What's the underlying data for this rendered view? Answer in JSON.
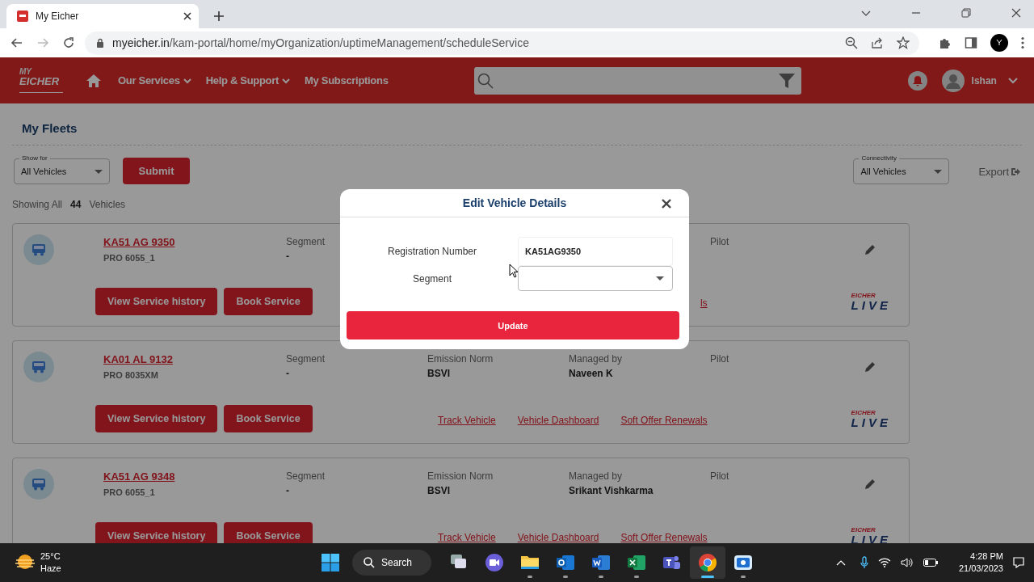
{
  "browser": {
    "tab": {
      "title": "My Eicher"
    },
    "url": {
      "host": "myeicher.in",
      "path": "/kam-portal/home/myOrganization/uptimeManagement/scheduleService"
    }
  },
  "header": {
    "logo": [
      "MY",
      "EICHER"
    ],
    "nav": [
      {
        "label": "Our Services",
        "dropdown": true
      },
      {
        "label": "Help & Support",
        "dropdown": true
      },
      {
        "label": "My Subscriptions",
        "dropdown": false
      }
    ],
    "user": {
      "name": "Ishan"
    }
  },
  "page": {
    "title": "My Fleets",
    "show_for": {
      "label": "Show for",
      "value": "All Vehicles"
    },
    "submit": "Submit",
    "connectivity": {
      "label": "Connectivity",
      "value": "All Vehicles"
    },
    "export": "Export",
    "showing": {
      "prefix": "Showing All",
      "count": "44",
      "suffix": "Vehicles"
    }
  },
  "vehicles": [
    {
      "registration": "KA51 AG 9350",
      "model": "PRO 6055_1",
      "fields": {
        "segment": {
          "label": "Segment",
          "value": "-"
        },
        "pilot": {
          "label": "Pilot"
        }
      },
      "buttons": [
        "View Service history",
        "Book Service"
      ],
      "links": [
        "ls"
      ],
      "badge": {
        "top": "EICHER",
        "main": "LIVE"
      }
    },
    {
      "registration": "KA01 AL 9132",
      "model": "PRO 8035XM",
      "fields": {
        "segment": {
          "label": "Segment",
          "value": "-"
        },
        "emission_norm": {
          "label": "Emission Norm",
          "value": "BSVI"
        },
        "managed_by": {
          "label": "Managed by",
          "value": "Naveen K"
        },
        "pilot": {
          "label": "Pilot"
        }
      },
      "buttons": [
        "View Service history",
        "Book Service"
      ],
      "links": [
        "Track Vehicle",
        "Vehicle Dashboard",
        "Soft Offer Renewals"
      ],
      "badge": {
        "top": "EICHER",
        "main": "LIVE"
      }
    },
    {
      "registration": "KA51 AG 9348",
      "model": "PRO 6055_1",
      "fields": {
        "segment": {
          "label": "Segment",
          "value": "-"
        },
        "emission_norm": {
          "label": "Emission Norm",
          "value": "BSVI"
        },
        "managed_by": {
          "label": "Managed by",
          "value": "Srikant Vishkarma"
        },
        "pilot": {
          "label": "Pilot"
        }
      },
      "buttons": [
        "View Service history",
        "Book Service"
      ],
      "links": [
        "Track Vehicle",
        "Vehicle Dashboard",
        "Soft Offer Renewals"
      ],
      "badge": {
        "top": "EICHER",
        "main": "LIVE"
      }
    }
  ],
  "dialog": {
    "title": "Edit Vehicle Details",
    "fields": [
      {
        "kind": "text",
        "label": "Registration Number",
        "value": "KA51AG9350"
      },
      {
        "kind": "select",
        "label": "Segment"
      }
    ],
    "button": "Update"
  },
  "taskbar": {
    "weather": {
      "temp": "25°C",
      "condition": "Haze"
    },
    "search": "Search",
    "apps": [
      {
        "kind": "taskview",
        "running": false,
        "selected": false
      },
      {
        "kind": "meet",
        "running": false,
        "selected": false
      },
      {
        "kind": "explorer",
        "running": true,
        "selected": false
      },
      {
        "kind": "outlook",
        "running": true,
        "selected": false
      },
      {
        "kind": "word",
        "running": true,
        "selected": false
      },
      {
        "kind": "excel",
        "running": true,
        "selected": false
      },
      {
        "kind": "teams",
        "running": false,
        "selected": false
      },
      {
        "kind": "chrome",
        "running": true,
        "selected": true
      },
      {
        "kind": "recorder",
        "running": true,
        "selected": false
      }
    ],
    "time": "4:28 PM",
    "date": "21/03/2023"
  }
}
